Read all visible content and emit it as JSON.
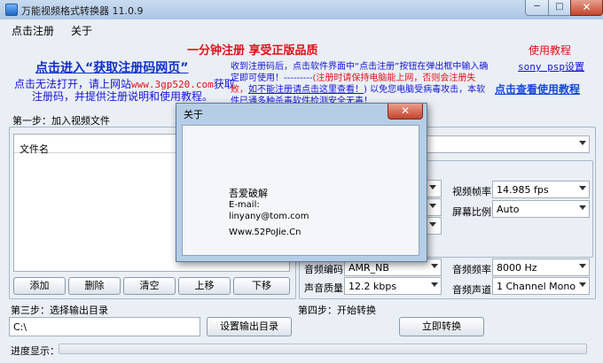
{
  "window": {
    "title": "万能视频格式转换器 11.0.9"
  },
  "menu": {
    "register": "点击注册",
    "about": "关于"
  },
  "banner": {
    "promo": "一分钟注册 享受正版品质",
    "get_code": "点击进入“获取注册码网页”",
    "cant_open_1": "点击无法打开，请上网站",
    "site": "www.3gp520.com",
    "cant_open_2": "获取",
    "cant_open_3": "注册码，并提供注册说明和使用教程。",
    "notice_1": "收到注册码后，点击软件界面中“点击注册”按钮在弹出框中输入确",
    "notice_2": "定即可使用！---------",
    "notice_2_red": "(注册时请保持电脑能上网，否则会注册失",
    "notice_3_red": "败，",
    "notice_3_link": "如不能注册请点击这里查看！",
    "notice_3_tail": ") 以免您电脑受病毒攻击，本软",
    "notice_4": "件已通多种杀毒软件检测安全无毒！",
    "tutorial": "使用教程",
    "sony_psp": "sony psp设置",
    "view_tutorial": "点击查看使用教程"
  },
  "step1": {
    "label": "第一步：加入视频文件",
    "file_header": "文件名",
    "buttons": {
      "add": "添加",
      "delete": "删除",
      "clear": "清空",
      "up": "上移",
      "down": "下移"
    }
  },
  "settings": {
    "frame_rate_label": "视频帧率",
    "frame_rate_value": "14.985 fps",
    "aspect_label": "屏幕比例",
    "aspect_value": "Auto",
    "audio_codec_label": "音频编码",
    "audio_codec_value": "AMR_NB",
    "audio_quality_label": "声音质量",
    "audio_quality_value": "12.2 kbps",
    "sample_rate_label": "音频频率",
    "sample_rate_value": "8000 Hz",
    "channels_label": "音频声道",
    "channels_value": "1 Channel Mono"
  },
  "step3": {
    "label": "第三步：选择输出目录",
    "path": "C:\\",
    "set_dir": "设置输出目录"
  },
  "step4": {
    "label": "第四步：开始转换",
    "convert": "立即转换"
  },
  "progress": {
    "label": "进度显示：",
    "value": 0
  },
  "about_dialog": {
    "title": "关于",
    "line1": "吾爱破解",
    "line2": "E-mail:",
    "line3": "linyany@tom.com",
    "line4": "Www.52PoJie.Cn"
  }
}
